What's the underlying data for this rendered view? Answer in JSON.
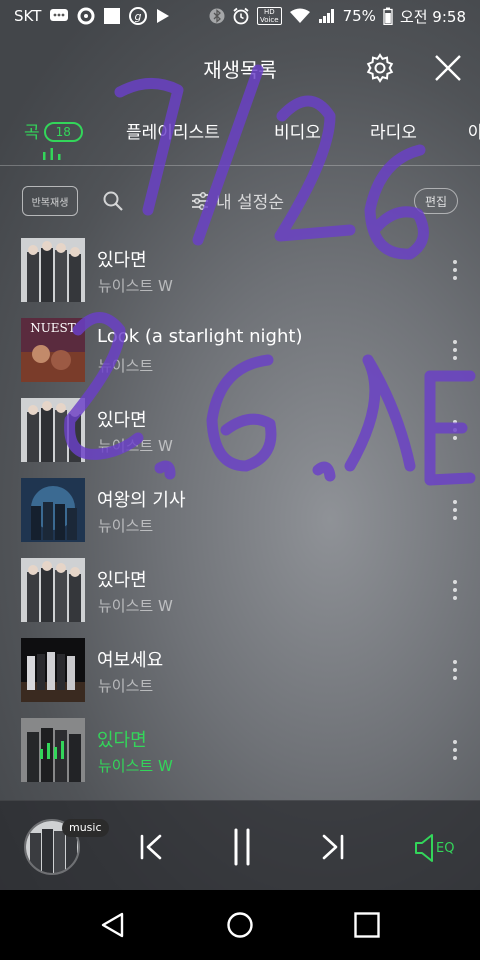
{
  "status_bar": {
    "carrier": "SKT",
    "hd_line1": "HD",
    "hd_line2": "Voice",
    "battery": "75%",
    "time": "오전 9:58"
  },
  "header": {
    "title": "재생목록"
  },
  "tabs": [
    {
      "label": "곡",
      "badge": "18",
      "active": true
    },
    {
      "label": "플레이리스트"
    },
    {
      "label": "비디오"
    },
    {
      "label": "라디오"
    },
    {
      "label": "아"
    }
  ],
  "toolbar": {
    "repeat_label": "반복재생",
    "sort_label": "내 설정순",
    "edit_label": "편집"
  },
  "songs": [
    {
      "title": "있다면",
      "artist": "뉴이스트 W",
      "art": "nuest-w-grey"
    },
    {
      "title": "Look (a starlight night)",
      "artist": "뉴이스트",
      "art": "nuest-look"
    },
    {
      "title": "있다면",
      "artist": "뉴이스트 W",
      "art": "nuest-w-grey"
    },
    {
      "title": "여왕의 기사",
      "artist": "뉴이스트",
      "art": "nuest-queen"
    },
    {
      "title": "있다면",
      "artist": "뉴이스트 W",
      "art": "nuest-w-grey"
    },
    {
      "title": "여보세요",
      "artist": "뉴이스트",
      "art": "nuest-hello"
    },
    {
      "title": "있다면",
      "artist": "뉴이스트 W",
      "art": "nuest-w-grey",
      "playing": true
    }
  ],
  "player": {
    "badge": "music",
    "eq_label": "EQ"
  },
  "handwriting": {
    "line1": "7/26",
    "line2": "2.6.1E"
  },
  "colors": {
    "accent": "#33d65a",
    "handwriting": "#6a3fc8"
  }
}
